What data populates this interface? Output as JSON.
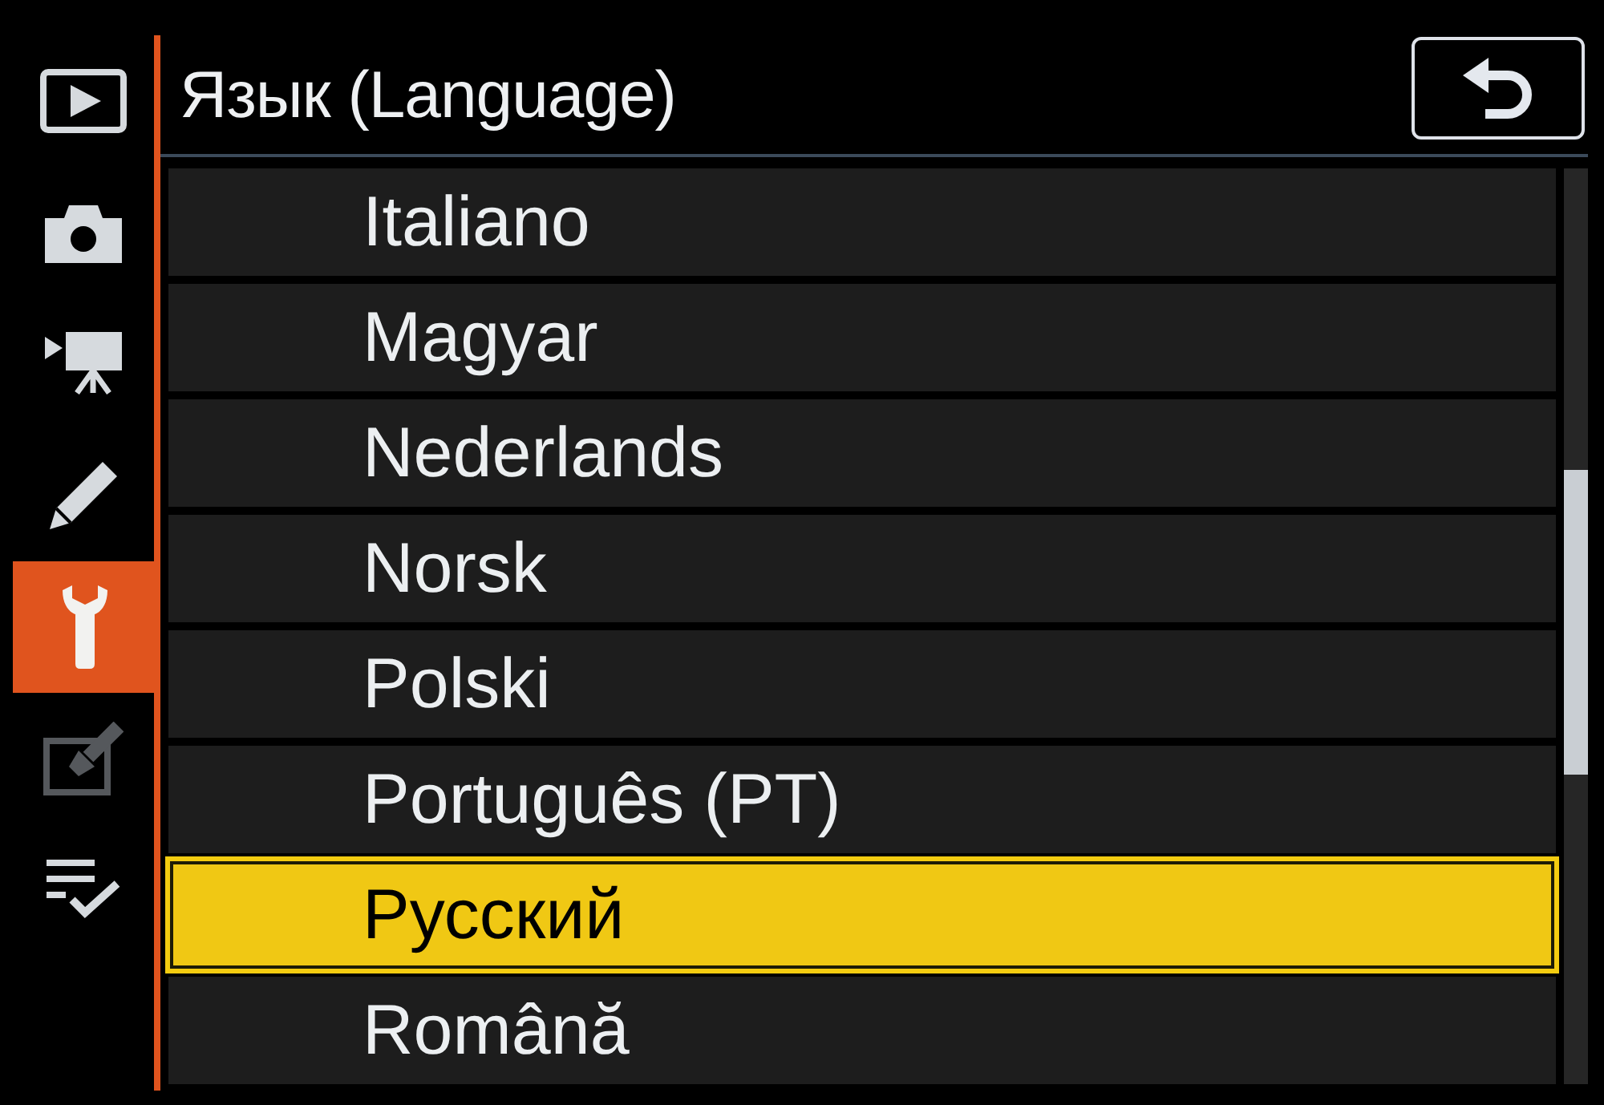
{
  "sidebar": {
    "items": [
      {
        "kind": "play",
        "selected": false,
        "disabled": false
      },
      {
        "kind": "camera",
        "selected": false,
        "disabled": false
      },
      {
        "kind": "movie",
        "selected": false,
        "disabled": false
      },
      {
        "kind": "pencil",
        "selected": false,
        "disabled": false
      },
      {
        "kind": "wrench",
        "selected": true,
        "disabled": false
      },
      {
        "kind": "retouch",
        "selected": false,
        "disabled": true
      },
      {
        "kind": "checklist",
        "selected": false,
        "disabled": false
      }
    ]
  },
  "header": {
    "title": "Язык (Language)"
  },
  "languages": [
    {
      "label": "Italiano",
      "selected": false
    },
    {
      "label": "Magyar",
      "selected": false
    },
    {
      "label": "Nederlands",
      "selected": false
    },
    {
      "label": "Norsk",
      "selected": false
    },
    {
      "label": "Polski",
      "selected": false
    },
    {
      "label": "Português (PT)",
      "selected": false
    },
    {
      "label": "Русский",
      "selected": true
    },
    {
      "label": "Română",
      "selected": false
    }
  ]
}
